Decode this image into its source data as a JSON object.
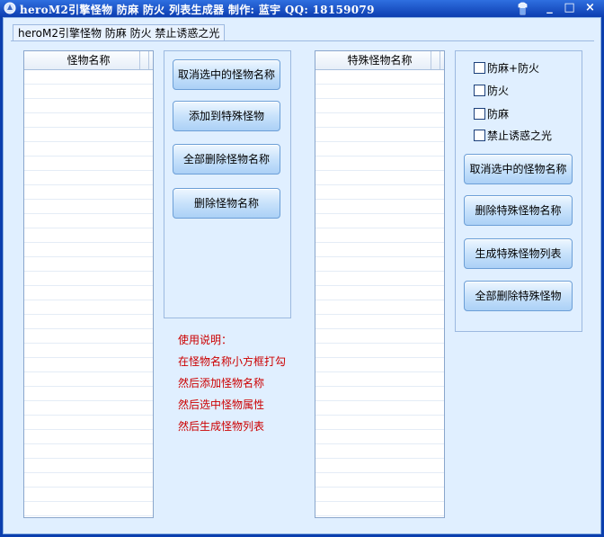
{
  "window": {
    "title": "heroM2引擎怪物 防麻 防火 列表生成器  制作: 蓝宇 QQ: 18159079",
    "min_label": "_",
    "max_label": "□",
    "close_label": "×"
  },
  "tab": {
    "label": "heroM2引擎怪物 防麻 防火 禁止诱惑之光"
  },
  "monster_list": {
    "header": "怪物名称"
  },
  "middle_buttons": {
    "deselect": "取消选中的怪物名称",
    "add_special": "添加到特殊怪物",
    "delete_all": "全部删除怪物名称",
    "delete": "删除怪物名称"
  },
  "instructions": {
    "title": "使用说明：",
    "lines": [
      "在怪物名称小方框打勾",
      "然后添加怪物名称",
      "然后选中怪物属性",
      "然后生成怪物列表"
    ]
  },
  "special_list": {
    "header": "特殊怪物名称"
  },
  "options": {
    "fangma_fanghuo": "防麻+防火",
    "fanghuo": "防火",
    "fangma": "防麻",
    "no_lure": "禁止诱惑之光"
  },
  "right_buttons": {
    "deselect": "取消选中的怪物名称",
    "delete_special": "删除特殊怪物名称",
    "generate": "生成特殊怪物列表",
    "delete_all_special": "全部删除特殊怪物"
  },
  "colors": {
    "titlebar": "#0c3db0",
    "client": "#e0efff",
    "note": "#cc0000"
  }
}
